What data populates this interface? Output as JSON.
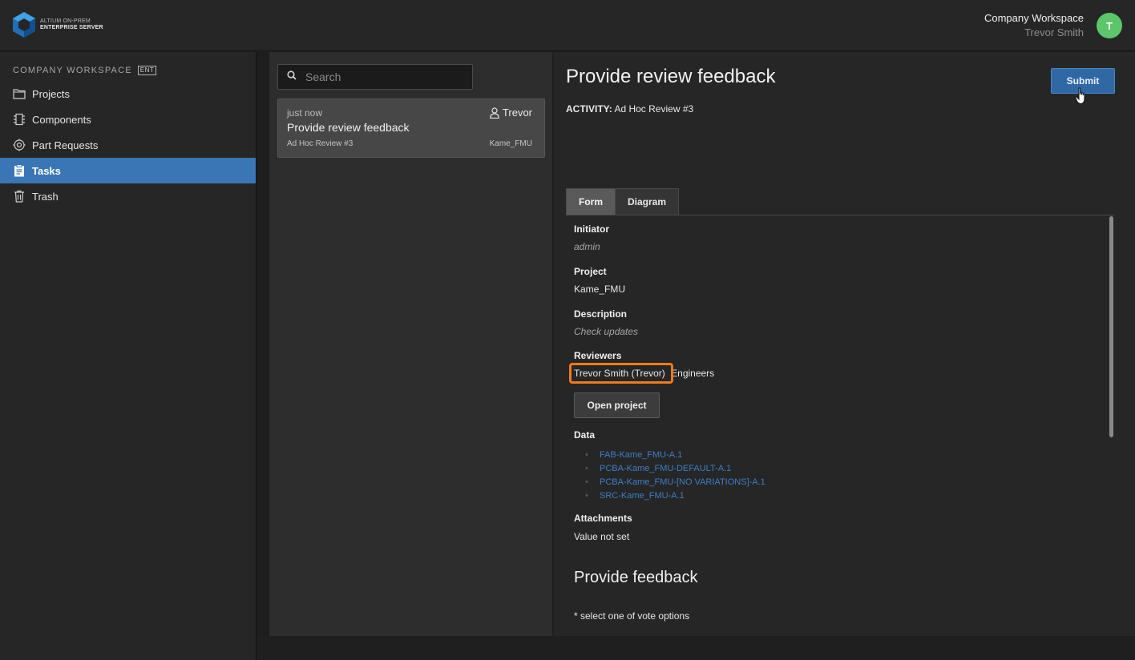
{
  "header": {
    "logo_line1": "ALTIUM ON-PREM",
    "logo_line2": "ENTERPRISE SERVER",
    "workspace": "Company Workspace",
    "user": "Trevor Smith",
    "avatar_initial": "T"
  },
  "sidebar": {
    "title": "COMPANY WORKSPACE",
    "badge": "ENT",
    "items": [
      {
        "label": "Projects",
        "icon": "folder-icon",
        "active": false
      },
      {
        "label": "Components",
        "icon": "chip-icon",
        "active": false
      },
      {
        "label": "Part Requests",
        "icon": "part-request-icon",
        "active": false
      },
      {
        "label": "Tasks",
        "icon": "clipboard-icon",
        "active": true
      },
      {
        "label": "Trash",
        "icon": "trash-icon",
        "active": false
      }
    ]
  },
  "task_list": {
    "search_placeholder": "Search",
    "tasks": [
      {
        "time": "just now",
        "assignee": "Trevor",
        "title": "Provide review feedback",
        "activity": "Ad Hoc Review #3",
        "project": "Kame_FMU"
      }
    ]
  },
  "detail": {
    "title": "Provide review feedback",
    "activity_label": "ACTIVITY:",
    "activity_value": "Ad Hoc Review #3",
    "submit_label": "Submit",
    "tabs": [
      "Form",
      "Diagram"
    ],
    "form": {
      "initiator_label": "Initiator",
      "initiator_value": "admin",
      "project_label": "Project",
      "project_value": "Kame_FMU",
      "description_label": "Description",
      "description_value": "Check updates",
      "reviewers_label": "Reviewers",
      "reviewer_1": "Trevor Smith (Trevor)",
      "reviewer_2": "Engineers",
      "open_project_label": "Open project",
      "data_label": "Data",
      "data_items": [
        "FAB-Kame_FMU-A.1",
        "PCBA-Kame_FMU-DEFAULT-A.1",
        "PCBA-Kame_FMU-[NO VARIATIONS]-A.1",
        "SRC-Kame_FMU-A.1"
      ],
      "attachments_label": "Attachments",
      "attachments_value": "Value not set",
      "feedback_title": "Provide feedback",
      "vote_note": "* select one of vote options"
    }
  },
  "colors": {
    "accent": "#3a76b5",
    "submit": "#3068a6",
    "avatar": "#5cc66a",
    "highlight": "#f07a1a",
    "link": "#3d7ec9"
  }
}
